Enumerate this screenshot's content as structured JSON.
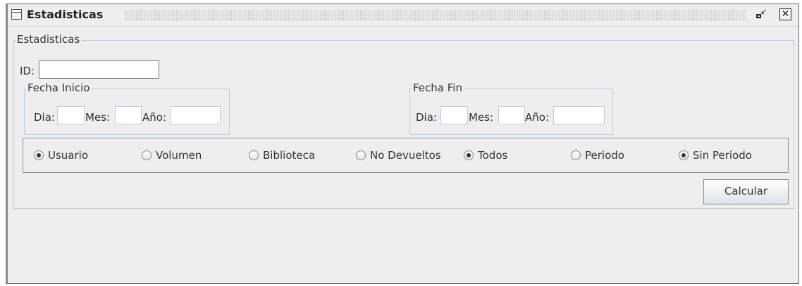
{
  "window": {
    "title": "Estadisticas"
  },
  "panel": {
    "title": "Estadisticas"
  },
  "id_field": {
    "label": "ID:",
    "value": ""
  },
  "fecha_inicio": {
    "title": "Fecha Inicio",
    "dia_label": "Dia:",
    "mes_label": "Mes:",
    "anio_label": "Año:",
    "dia": "",
    "mes": "",
    "anio": ""
  },
  "fecha_fin": {
    "title": "Fecha Fin",
    "dia_label": "Dia:",
    "mes_label": "Mes:",
    "anio_label": "Año:",
    "dia": "",
    "mes": "",
    "anio": ""
  },
  "options": [
    {
      "label": "Usuario",
      "selected": true
    },
    {
      "label": "Volumen",
      "selected": false
    },
    {
      "label": "Biblioteca",
      "selected": false
    },
    {
      "label": "No Devueltos",
      "selected": false
    },
    {
      "label": "Todos",
      "selected": true
    },
    {
      "label": "Periodo",
      "selected": false
    },
    {
      "label": "Sin Periodo",
      "selected": true
    }
  ],
  "actions": {
    "calcular": "Calcular"
  }
}
